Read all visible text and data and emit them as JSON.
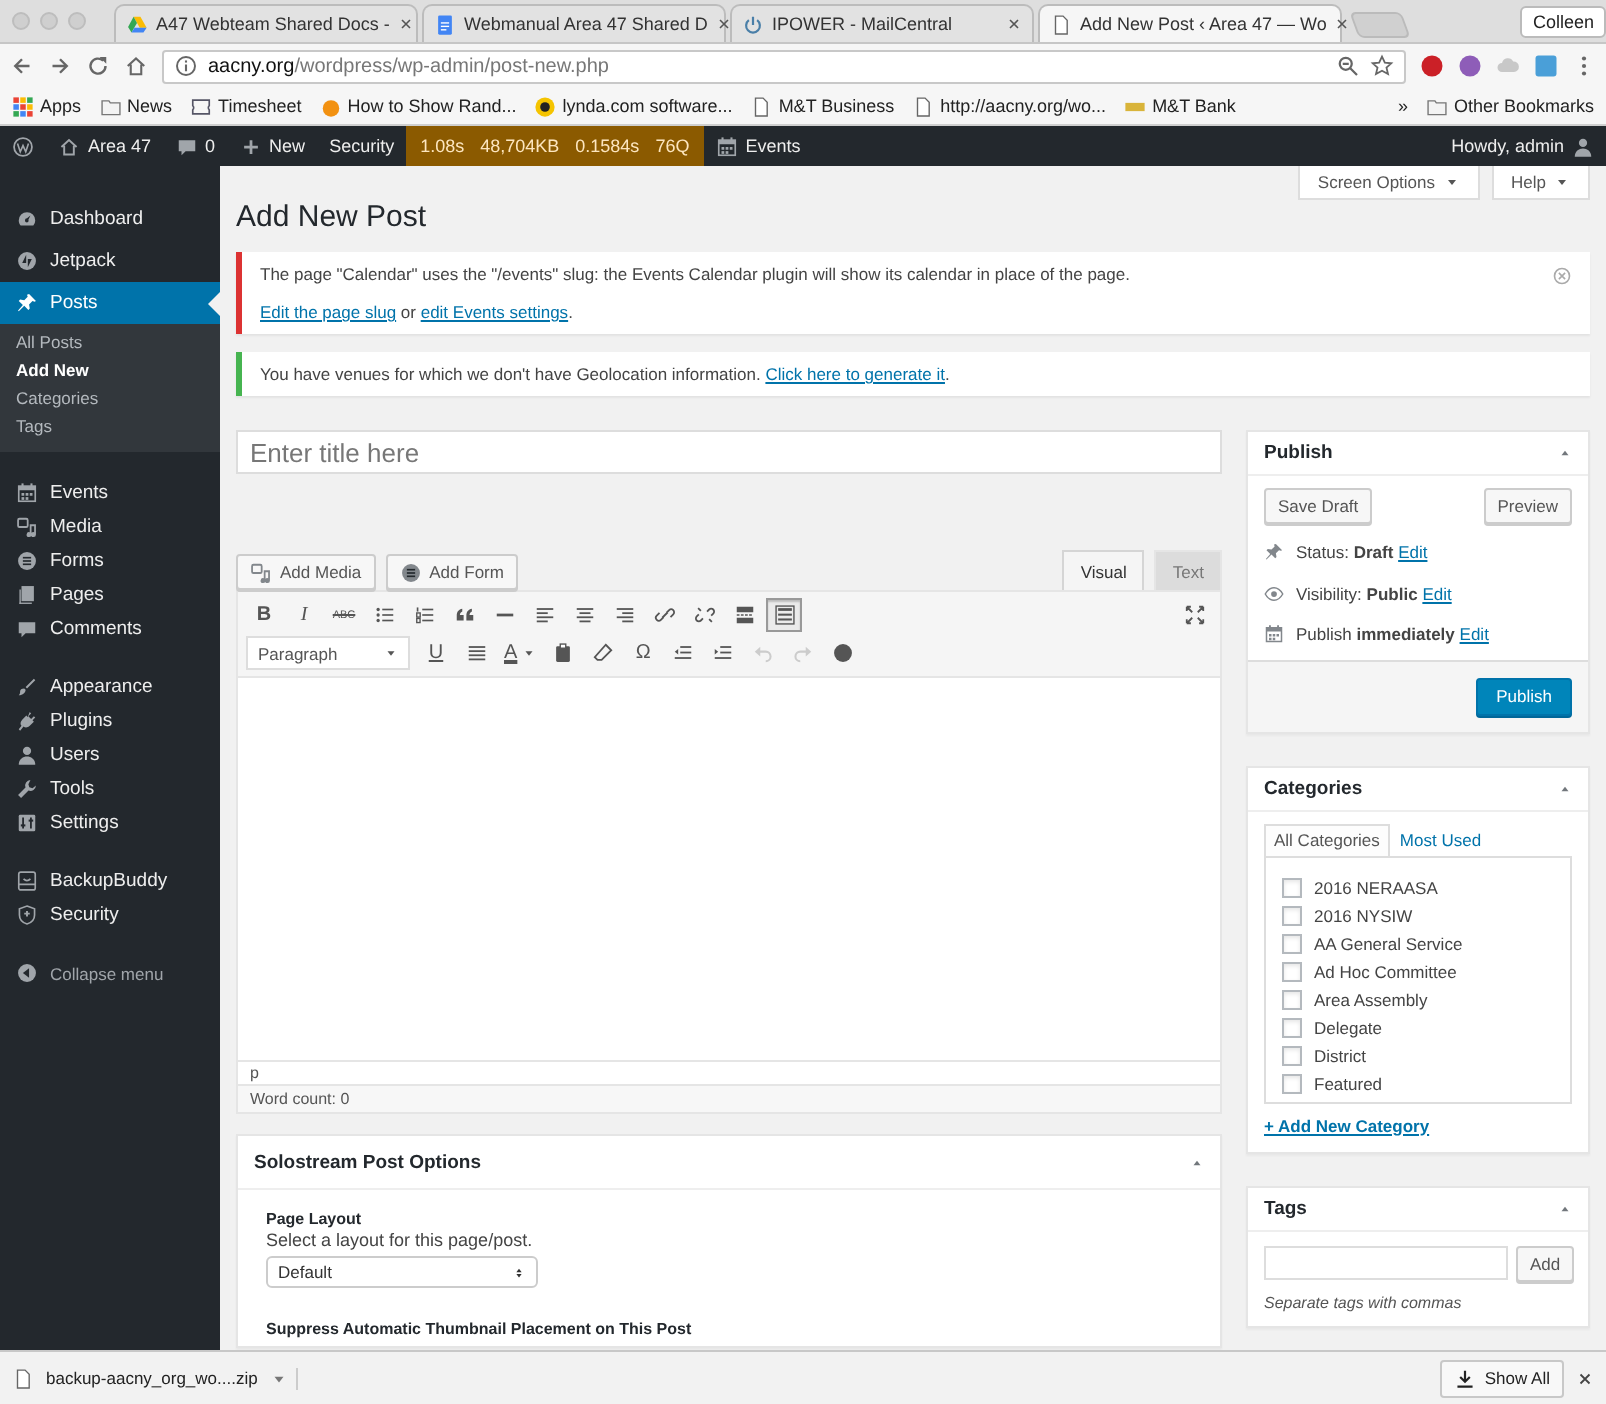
{
  "browser": {
    "tabs": [
      {
        "title": "A47 Webteam Shared Docs -",
        "selected": false
      },
      {
        "title": "Webmanual Area 47 Shared D",
        "selected": false
      },
      {
        "title": "IPOWER - MailCentral",
        "selected": false
      },
      {
        "title": "Add New Post ‹ Area 47 — Wo",
        "selected": true
      }
    ],
    "profile": "Colleen",
    "address": {
      "host": "aacny.org",
      "path": "/wordpress/wp-admin/post-new.php"
    },
    "bookmarks": [
      {
        "kind": "apps",
        "label": "Apps"
      },
      {
        "kind": "folder",
        "label": "News"
      },
      {
        "kind": "shield",
        "label": "Timesheet"
      },
      {
        "kind": "orange",
        "label": "How to Show Rand..."
      },
      {
        "kind": "lynda",
        "label": "lynda.com software..."
      },
      {
        "kind": "page",
        "label": "M&T Business"
      },
      {
        "kind": "page",
        "label": "http://aacny.org/wo..."
      },
      {
        "kind": "bank",
        "label": "M&T Bank"
      }
    ],
    "overflow": "»",
    "other_bookmarks": "Other Bookmarks"
  },
  "admin_bar": {
    "site": "Area 47",
    "comments": "0",
    "new": "New",
    "security": "Security",
    "stats": [
      "1.08s",
      "48,704KB",
      "0.1584s",
      "76Q"
    ],
    "events": "Events",
    "greeting": "Howdy, admin"
  },
  "sidebar": {
    "groups": [
      [
        {
          "label": "Dashboard",
          "selected": false
        },
        {
          "label": "Jetpack",
          "selected": false
        },
        {
          "label": "Posts",
          "selected": true,
          "children": [
            {
              "label": "All Posts",
              "selected": false
            },
            {
              "label": "Add New",
              "selected": true
            },
            {
              "label": "Categories",
              "selected": false
            },
            {
              "label": "Tags",
              "selected": false
            }
          ]
        }
      ],
      [
        {
          "label": "Events",
          "selected": false
        },
        {
          "label": "Media",
          "selected": false
        },
        {
          "label": "Forms",
          "selected": false
        },
        {
          "label": "Pages",
          "selected": false
        },
        {
          "label": "Comments",
          "selected": false
        }
      ],
      [
        {
          "label": "Appearance",
          "selected": false
        },
        {
          "label": "Plugins",
          "selected": false
        },
        {
          "label": "Users",
          "selected": false
        },
        {
          "label": "Tools",
          "selected": false
        },
        {
          "label": "Settings",
          "selected": false
        }
      ],
      [
        {
          "label": "BackupBuddy",
          "selected": false
        },
        {
          "label": "Security",
          "selected": false
        }
      ]
    ],
    "collapse": "Collapse menu"
  },
  "page": {
    "title": "Add New Post",
    "screen_options": "Screen Options",
    "help": "Help"
  },
  "notices": [
    {
      "color": "#dc3232",
      "dismissible": true,
      "paragraphs": [
        [
          {
            "text": "The page \"Calendar\" uses the \"/events\" slug: the Events Calendar plugin will show its calendar in place of the page.",
            "link": false
          }
        ],
        [
          {
            "text": "Edit the page slug",
            "link": true
          },
          {
            "text": " or ",
            "link": false
          },
          {
            "text": "edit Events settings",
            "link": true
          },
          {
            "text": ".",
            "link": false
          }
        ]
      ]
    },
    {
      "color": "#46b450",
      "dismissible": false,
      "paragraphs": [
        [
          {
            "text": "You have venues for which we don't have Geolocation information. ",
            "link": false
          },
          {
            "text": "Click here to generate it",
            "link": true
          },
          {
            "text": ".",
            "link": false
          }
        ]
      ]
    }
  ],
  "title_field": {
    "placeholder": "Enter title here"
  },
  "editor": {
    "media_buttons": [
      "Add Media",
      "Add Form"
    ],
    "tabs": [
      {
        "label": "Visual",
        "selected": true
      },
      {
        "label": "Text",
        "selected": false
      }
    ],
    "toolbar": [
      [
        {
          "kind": "bold",
          "text": "B",
          "pressed": false,
          "disabled": false
        },
        {
          "kind": "italic",
          "text": "I",
          "pressed": false,
          "disabled": false
        },
        {
          "kind": "strike",
          "text": "ABC",
          "pressed": false,
          "disabled": false
        },
        {
          "kind": "bullets",
          "pressed": false,
          "disabled": false
        },
        {
          "kind": "numbers",
          "pressed": false,
          "disabled": false
        },
        {
          "kind": "quote",
          "pressed": false,
          "disabled": false
        },
        {
          "kind": "rule",
          "pressed": false,
          "disabled": false
        },
        {
          "kind": "align-left",
          "pressed": false,
          "disabled": false
        },
        {
          "kind": "align-center",
          "pressed": false,
          "disabled": false
        },
        {
          "kind": "align-right",
          "pressed": false,
          "disabled": false
        },
        {
          "kind": "link",
          "pressed": false,
          "disabled": false
        },
        {
          "kind": "unlink",
          "pressed": false,
          "disabled": false
        },
        {
          "kind": "more",
          "pressed": false,
          "disabled": false
        },
        {
          "kind": "toggle",
          "pressed": true,
          "disabled": false
        },
        {
          "kind": "fullscreen",
          "pressed": false,
          "disabled": false
        }
      ],
      [
        {
          "kind": "format",
          "text": "Paragraph",
          "pressed": false,
          "disabled": false
        },
        {
          "kind": "underline",
          "text": "U",
          "pressed": false,
          "disabled": false
        },
        {
          "kind": "justify",
          "pressed": false,
          "disabled": false
        },
        {
          "kind": "text-color",
          "text": "A",
          "pressed": false,
          "disabled": false
        },
        {
          "kind": "paste",
          "pressed": false,
          "disabled": false
        },
        {
          "kind": "clear",
          "pressed": false,
          "disabled": false
        },
        {
          "kind": "charmap",
          "text": "Ω",
          "pressed": false,
          "disabled": false
        },
        {
          "kind": "outdent",
          "pressed": false,
          "disabled": false
        },
        {
          "kind": "indent",
          "pressed": false,
          "disabled": false
        },
        {
          "kind": "undo",
          "pressed": false,
          "disabled": true
        },
        {
          "kind": "redo",
          "pressed": false,
          "disabled": true
        },
        {
          "kind": "help",
          "pressed": false,
          "disabled": false
        }
      ]
    ],
    "path": "p",
    "word_count": "Word count: 0"
  },
  "post_options": {
    "title": "Solostream Post Options",
    "fields": [
      {
        "label": "Page Layout",
        "description": "Select a layout for this page/post.",
        "value": "Default"
      },
      {
        "label": "Suppress Automatic Thumbnail Placement on This Post"
      }
    ]
  },
  "publish": {
    "title": "Publish",
    "save_draft": "Save Draft",
    "preview": "Preview",
    "rows": [
      {
        "label": "Status:",
        "value": "Draft",
        "link": "Edit"
      },
      {
        "label": "Visibility:",
        "value": "Public",
        "link": "Edit"
      },
      {
        "label": "Publish",
        "value": "immediately",
        "link": "Edit"
      }
    ],
    "button": "Publish"
  },
  "categories": {
    "title": "Categories",
    "tabs": [
      {
        "label": "All Categories",
        "selected": true
      },
      {
        "label": "Most Used",
        "selected": false
      }
    ],
    "items": [
      {
        "label": "2016 NERAASA",
        "checked": false
      },
      {
        "label": "2016 NYSIW",
        "checked": false
      },
      {
        "label": "AA General Service",
        "checked": false
      },
      {
        "label": "Ad Hoc Committee",
        "checked": false
      },
      {
        "label": "Area Assembly",
        "checked": false
      },
      {
        "label": "Delegate",
        "checked": false
      },
      {
        "label": "District",
        "checked": false
      },
      {
        "label": "Featured",
        "checked": false
      }
    ],
    "add_link": "+ Add New Category"
  },
  "tags": {
    "title": "Tags",
    "button": "Add",
    "hint": "Separate tags with commas"
  },
  "download_bar": {
    "file": "backup-aacny_org_wo....zip",
    "show_all": "Show All"
  }
}
